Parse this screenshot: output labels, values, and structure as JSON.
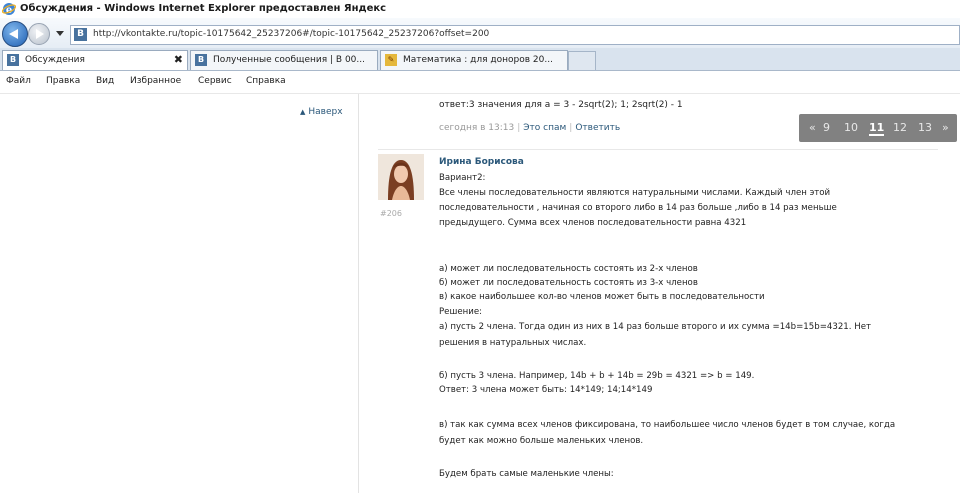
{
  "window": {
    "title": "Обсуждения - Windows Internet Explorer предоставлен Яндекс"
  },
  "address": {
    "url": "http://vkontakte.ru/topic-10175642_25237206#/topic-10175642_25237206?offset=200",
    "favicon": "В"
  },
  "tabs": [
    {
      "label": "Обсуждения",
      "icon": "vk-favicon",
      "active": true
    },
    {
      "label": "Полученные сообщения | В 00...",
      "icon": "vk-favicon",
      "active": false
    },
    {
      "label": "Математика : для доноров 20...",
      "icon": "pencil-favicon",
      "active": false
    }
  ],
  "menu": [
    "Файл",
    "Правка",
    "Вид",
    "Избранное",
    "Сервис",
    "Справка"
  ],
  "sidebar": {
    "up_label": "Наверх"
  },
  "previous_post": {
    "text": "ответ:3 значения для a = 3 - 2sqrt(2); 1; 2sqrt(2) - 1",
    "time": "сегодня в 13:13",
    "spam_link": "Это спам",
    "reply_link": "Ответить"
  },
  "pager": {
    "prev": "«",
    "pages": [
      "9",
      "10",
      "11",
      "12",
      "13"
    ],
    "current": "11",
    "next": "»"
  },
  "post": {
    "author": "Ирина Борисова",
    "number": "#206",
    "lines": [
      "Вариант2:",
      "Все члены последовательности являются натуральными числами. Каждый член этой",
      "последовательности , начиная со второго либо в 14 раз больше ,либо в 14 раз меньше",
      "предыдущего. Сумма всех членов последовательности равна 4321",
      "",
      "а) может ли последовательность состоять из 2-х членов",
      "б) может ли последовательность состоять из 3-х членов",
      "в) какое наибольшее кол-во членов может быть в последовательности",
      "Решение:",
      "а) пусть 2 члена. Тогда один из них в 14 раз больше второго и их сумма =14b=15b=4321. Нет",
      "решения в натуральных числах.",
      "",
      "б) пусть 3 члена. Например, 14b + b + 14b = 29b = 4321 => b = 149.",
      "Ответ: 3 члена может быть: 14*149; 14;14*149",
      "",
      "в) так как сумма всех членов фиксирована, то наибольшее число членов будет в том случае, когда",
      "будет как можно больше маленьких членов.",
      "",
      "Будем брать самые маленькие члены:"
    ]
  }
}
